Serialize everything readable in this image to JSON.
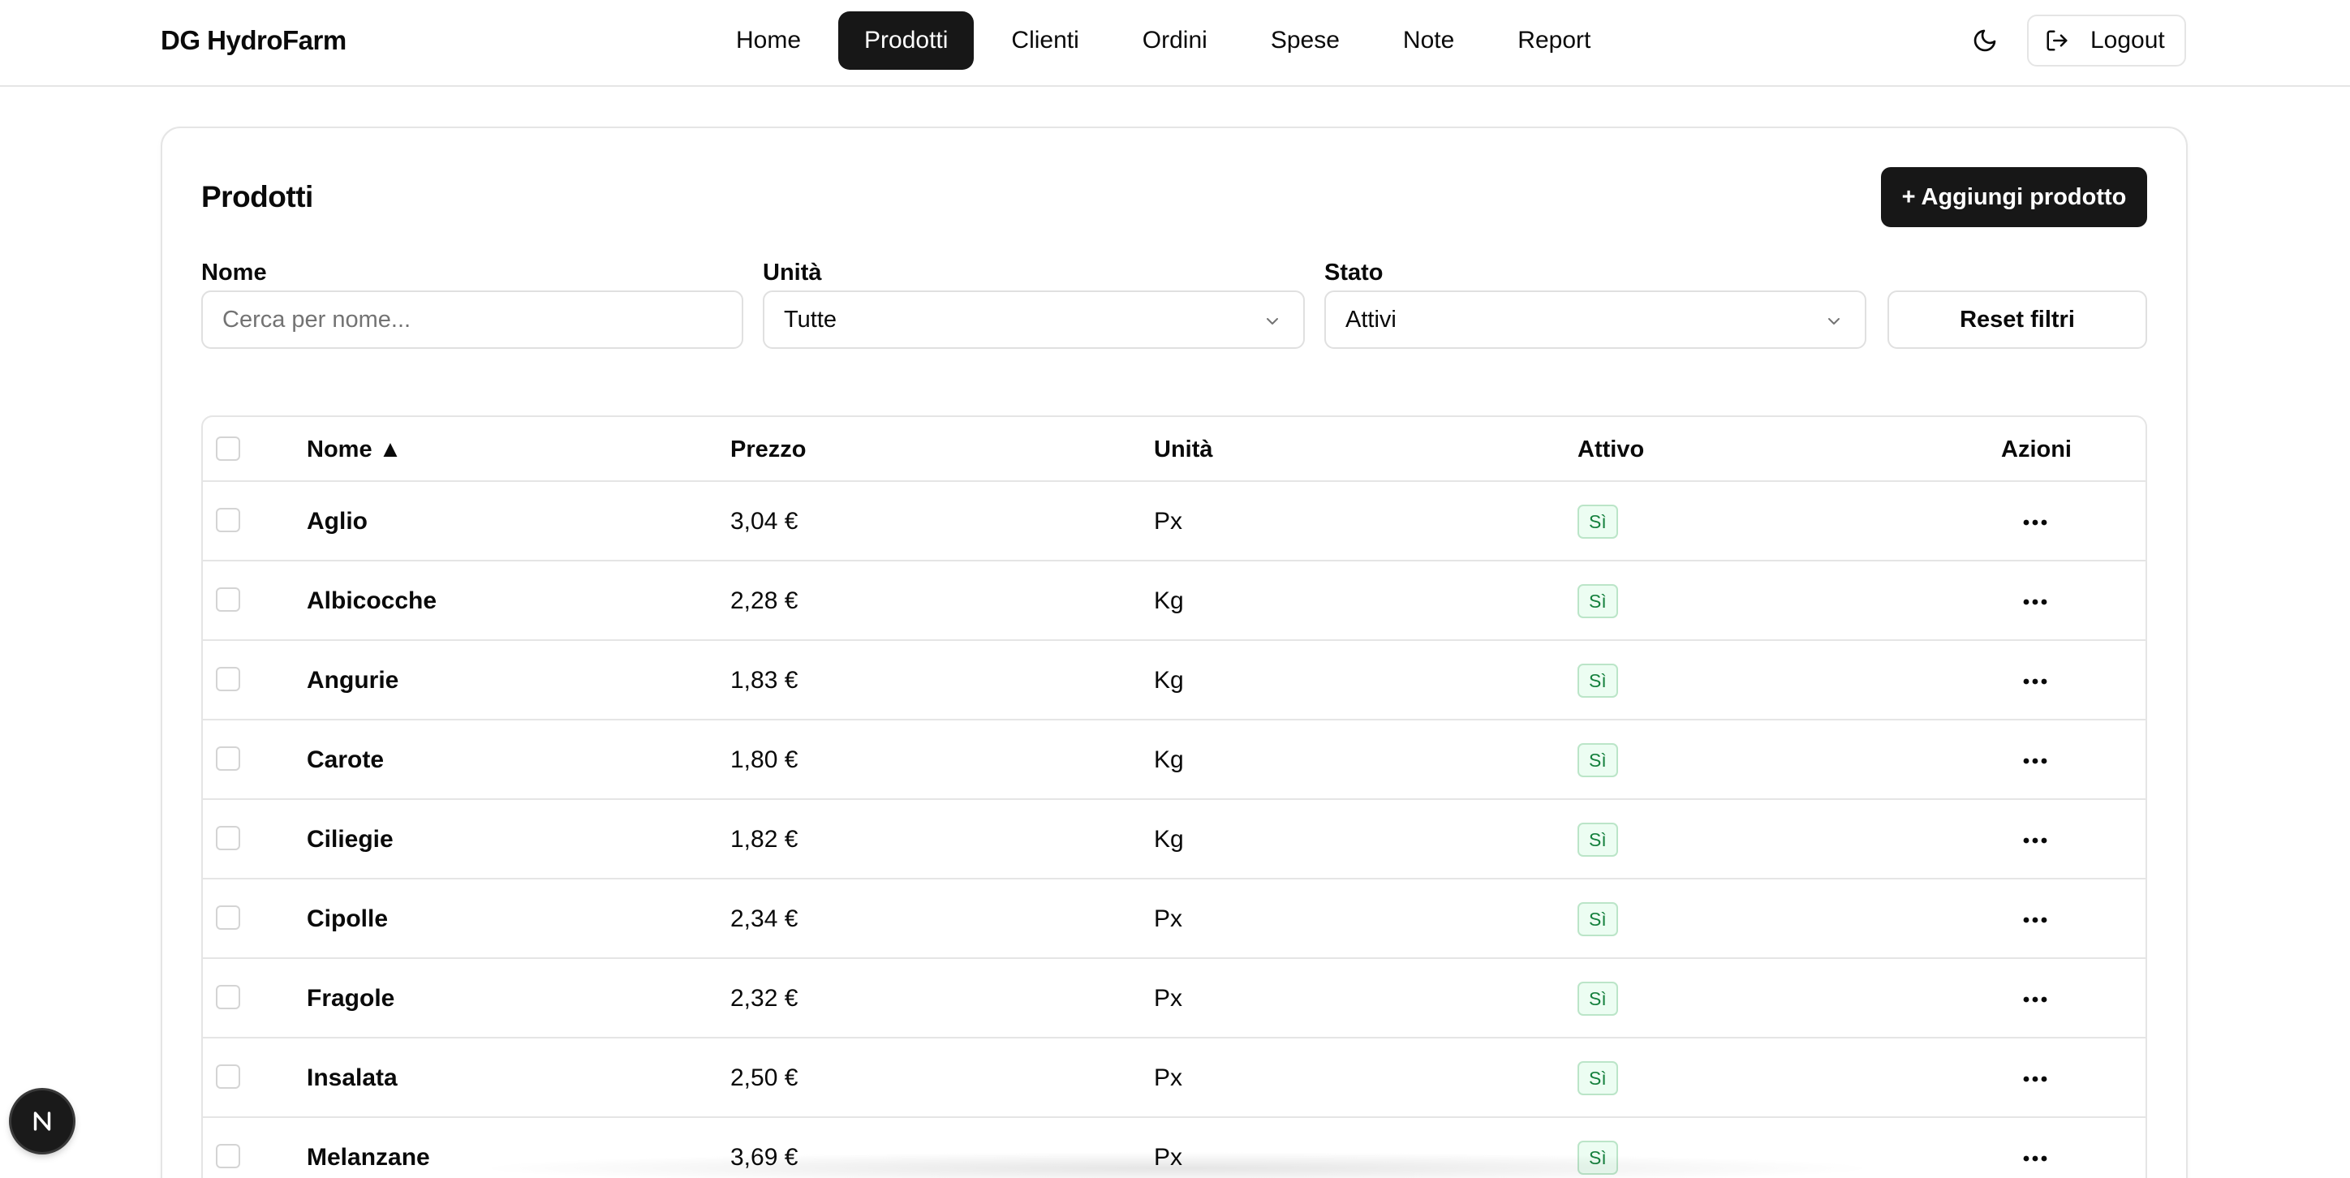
{
  "header": {
    "brand": "DG HydroFarm",
    "nav": [
      {
        "label": "Home",
        "active": false
      },
      {
        "label": "Prodotti",
        "active": true
      },
      {
        "label": "Clienti",
        "active": false
      },
      {
        "label": "Ordini",
        "active": false
      },
      {
        "label": "Spese",
        "active": false
      },
      {
        "label": "Note",
        "active": false
      },
      {
        "label": "Report",
        "active": false
      }
    ],
    "theme_icon": "moon-icon",
    "logout_label": "Logout",
    "logout_icon": "logout-icon"
  },
  "page": {
    "title": "Prodotti",
    "add_button": "+ Aggiungi prodotto"
  },
  "filters": {
    "name_label": "Nome",
    "name_placeholder": "Cerca per nome...",
    "unit_label": "Unità",
    "unit_value": "Tutte",
    "status_label": "Stato",
    "status_value": "Attivi",
    "reset_label": "Reset filtri"
  },
  "table": {
    "headers": {
      "name": "Nome ▲",
      "price": "Prezzo",
      "unit": "Unità",
      "active": "Attivo",
      "actions": "Azioni"
    },
    "rows": [
      {
        "name": "Aglio",
        "price": "3,04 €",
        "unit": "Px",
        "active": "Sì"
      },
      {
        "name": "Albicocche",
        "price": "2,28 €",
        "unit": "Kg",
        "active": "Sì"
      },
      {
        "name": "Angurie",
        "price": "1,83 €",
        "unit": "Kg",
        "active": "Sì"
      },
      {
        "name": "Carote",
        "price": "1,80 €",
        "unit": "Kg",
        "active": "Sì"
      },
      {
        "name": "Ciliegie",
        "price": "1,82 €",
        "unit": "Kg",
        "active": "Sì"
      },
      {
        "name": "Cipolle",
        "price": "2,34 €",
        "unit": "Px",
        "active": "Sì"
      },
      {
        "name": "Fragole",
        "price": "2,32 €",
        "unit": "Px",
        "active": "Sì"
      },
      {
        "name": "Insalata",
        "price": "2,50 €",
        "unit": "Px",
        "active": "Sì"
      },
      {
        "name": "Melanzane",
        "price": "3,69 €",
        "unit": "Px",
        "active": "Sì"
      }
    ]
  },
  "colors": {
    "primary": "#171717",
    "border": "#e5e5e5",
    "badge_bg": "#ecfdf2",
    "badge_text": "#15803d"
  }
}
